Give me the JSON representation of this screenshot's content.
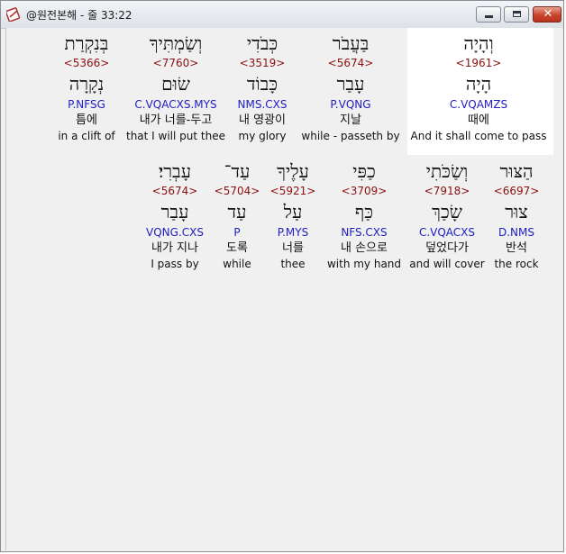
{
  "window": {
    "title": "@원전본해 - 줄 33:22"
  },
  "row1": [
    {
      "hebrew": "וְהָיָה",
      "strong": "<1961>",
      "lemma": "הָיָה",
      "parse": "C.VQAMZS",
      "korean": "때에",
      "english": "And it shall come to pass"
    },
    {
      "hebrew": "בַּעֲבֹר",
      "strong": "<5674>",
      "lemma": "עָבַר",
      "parse": "P.VQNG",
      "korean": "지날",
      "english": "while - passeth by"
    },
    {
      "hebrew": "כְּבֹדִי",
      "strong": "<3519>",
      "lemma": "כָּבוֹד",
      "parse": "NMS.CXS",
      "korean": "내 영광이",
      "english": "my glory"
    },
    {
      "hebrew": "וְשַׂמְתִּיךָ",
      "strong": "<7760>",
      "lemma": "שׂוּם",
      "parse": "C.VQACXS.MYS",
      "korean": "내가 너를-두고",
      "english": "that I will put thee"
    },
    {
      "hebrew": "בְּנִקְרַת",
      "strong": "<5366>",
      "lemma": "נְקָרָה",
      "parse": "P.NFSG",
      "korean": "틈에",
      "english": "in a clift of"
    }
  ],
  "row2": [
    {
      "hebrew": "הַצּוּר",
      "strong": "<6697>",
      "lemma": "צוּר",
      "parse": "D.NMS",
      "korean": "반석",
      "english": "the rock"
    },
    {
      "hebrew": "וְשַׂכֹּתִי",
      "strong": "<7918>",
      "lemma": "שָׂכַךְ",
      "parse": "C.VQACXS",
      "korean": "덮었다가",
      "english": "and will cover"
    },
    {
      "hebrew": "כַפִּי",
      "strong": "<3709>",
      "lemma": "כַּף",
      "parse": "NFS.CXS",
      "korean": "내 손으로",
      "english": "with my hand"
    },
    {
      "hebrew": "עָלֶיךָ",
      "strong": "<5921>",
      "lemma": "עַל",
      "parse": "P.MYS",
      "korean": "너를",
      "english": "thee"
    },
    {
      "hebrew": "עַד־",
      "strong": "<5704>",
      "lemma": "עַד",
      "parse": "P",
      "korean": "도록",
      "english": "while"
    },
    {
      "hebrew": "עָבְרִי׃",
      "strong": "<5674>",
      "lemma": "עָבַר",
      "parse": "VQNG.CXS",
      "korean": "내가 지나",
      "english": "I pass by"
    }
  ],
  "colors": {
    "strong": "#8b1010",
    "parse": "#2020c0",
    "highlight": "#ffffff",
    "background": "#f0f0f0"
  },
  "icons": {
    "app": "bible-app-icon",
    "minimize": "minimize-icon",
    "maximize": "maximize-icon",
    "close": "close-icon"
  }
}
